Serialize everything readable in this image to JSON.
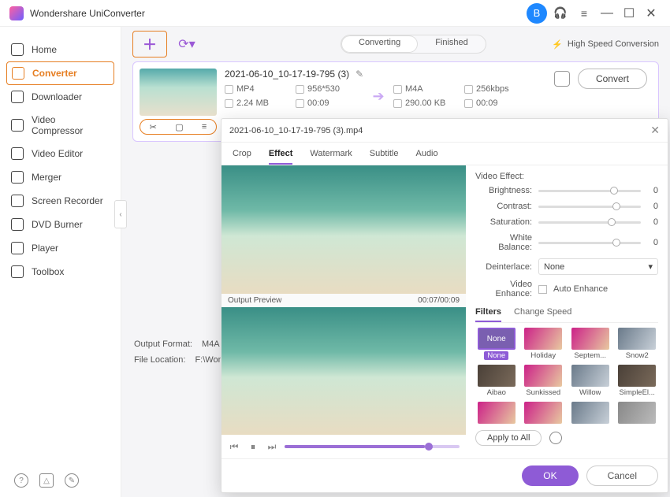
{
  "app": {
    "title": "Wondershare UniConverter"
  },
  "window": {
    "user_initial": "B"
  },
  "sidebar": {
    "items": [
      {
        "label": "Home",
        "icon": "home-icon"
      },
      {
        "label": "Converter",
        "icon": "converter-icon",
        "active": true
      },
      {
        "label": "Downloader",
        "icon": "downloader-icon"
      },
      {
        "label": "Video Compressor",
        "icon": "compressor-icon"
      },
      {
        "label": "Video Editor",
        "icon": "editor-icon"
      },
      {
        "label": "Merger",
        "icon": "merger-icon"
      },
      {
        "label": "Screen Recorder",
        "icon": "recorder-icon"
      },
      {
        "label": "DVD Burner",
        "icon": "dvd-icon"
      },
      {
        "label": "Player",
        "icon": "player-icon"
      },
      {
        "label": "Toolbox",
        "icon": "toolbox-icon"
      }
    ]
  },
  "toolbar": {
    "tabs": {
      "converting": "Converting",
      "finished": "Finished",
      "active": "converting"
    },
    "high_speed": "High Speed Conversion"
  },
  "card": {
    "title": "2021-06-10_10-17-19-795 (3)",
    "src": {
      "format": "MP4",
      "resolution": "956*530",
      "size": "2.24 MB",
      "duration": "00:09"
    },
    "dst": {
      "format": "M4A",
      "bitrate": "256kbps",
      "size": "290.00 KB",
      "duration": "00:09"
    },
    "convert_label": "Convert"
  },
  "bottom": {
    "output_format_label": "Output Format:",
    "output_format_value": "M4A",
    "file_location_label": "File Location:",
    "file_location_value": "F:\\Wonder"
  },
  "dialog": {
    "filename": "2021-06-10_10-17-19-795 (3).mp4",
    "tabs": [
      "Crop",
      "Effect",
      "Watermark",
      "Subtitle",
      "Audio"
    ],
    "active_tab": "Effect",
    "preview_label": "Output Preview",
    "time": "00:07/00:09",
    "video_effect": {
      "title": "Video Effect:",
      "brightness_label": "Brightness:",
      "brightness_value": "0",
      "contrast_label": "Contrast:",
      "contrast_value": "0",
      "saturation_label": "Saturation:",
      "saturation_value": "0",
      "white_balance_label": "White Balance:",
      "white_balance_value": "0",
      "deinterlace_label": "Deinterlace:",
      "deinterlace_value": "None",
      "video_enhance_label": "Video Enhance:",
      "auto_enhance_label": "Auto Enhance"
    },
    "sub_tabs": {
      "filters": "Filters",
      "change_speed": "Change Speed",
      "active": "filters"
    },
    "filters": [
      {
        "label": "None",
        "active": true,
        "variant": "none"
      },
      {
        "label": "Holiday",
        "variant": "warm"
      },
      {
        "label": "Septem...",
        "variant": "warm"
      },
      {
        "label": "Snow2",
        "variant": "cool"
      },
      {
        "label": "Aibao",
        "variant": "dark"
      },
      {
        "label": "Sunkissed",
        "variant": "warm"
      },
      {
        "label": "Willow",
        "variant": "cool"
      },
      {
        "label": "SimpleEl...",
        "variant": "dark"
      },
      {
        "label": "",
        "variant": "warm"
      },
      {
        "label": "",
        "variant": "warm"
      },
      {
        "label": "",
        "variant": "cool"
      },
      {
        "label": "",
        "variant": "gray"
      }
    ],
    "apply_all": "Apply to All",
    "ok": "OK",
    "cancel": "Cancel"
  }
}
